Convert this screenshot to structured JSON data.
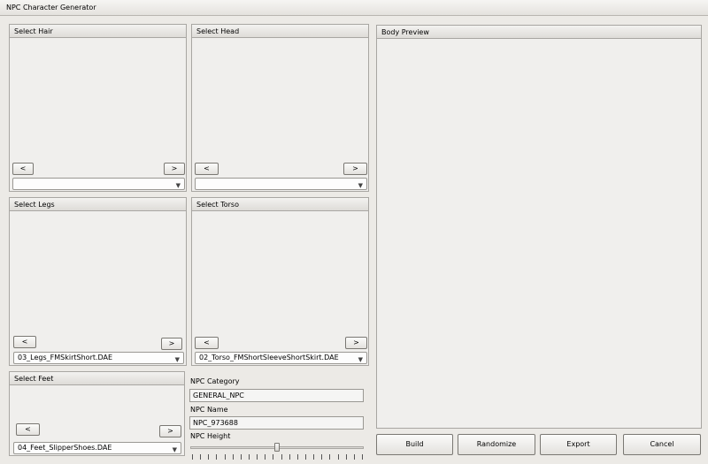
{
  "window": {
    "title": "NPC Character Generator"
  },
  "panels": {
    "hair": {
      "title": "Select Hair",
      "prev": "<",
      "next": ">",
      "selected": ""
    },
    "head": {
      "title": "Select Head",
      "prev": "<",
      "next": ">",
      "selected": ""
    },
    "legs": {
      "title": "Select Legs",
      "prev": "<",
      "next": ">",
      "selected": "03_Legs_FMSkirtShort.DAE"
    },
    "torso": {
      "title": "Select Torso",
      "prev": "<",
      "next": ">",
      "selected": "02_Torso_FMShortSleeveShortSkirt.DAE"
    },
    "feet": {
      "title": "Select Feet",
      "prev": "<",
      "next": ">",
      "selected": "04_Feet_SlipperShoes.DAE"
    },
    "preview": {
      "title": "Body Preview"
    }
  },
  "npc": {
    "category_label": "NPC Category",
    "category_value": "GENERAL_NPC",
    "name_label": "NPC Name",
    "name_value": "NPC_973688",
    "height_label": "NPC Height",
    "height_level": 0.5
  },
  "actions": {
    "build": "Build",
    "randomize": "Randomize",
    "export": "Export",
    "cancel": "Cancel"
  },
  "icons": {
    "combo_arrow": "chevron-down-icon"
  }
}
